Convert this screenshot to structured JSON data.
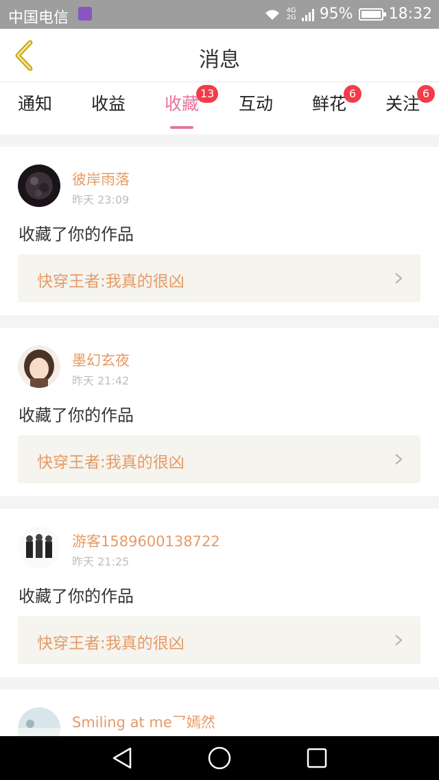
{
  "status_bar": {
    "carrier": "中国电信",
    "network_top": "4G",
    "network_bottom": "2G",
    "battery": "95%",
    "time": "18:32"
  },
  "header": {
    "title": "消息",
    "back_icon": "chevron-left-icon"
  },
  "tabs": [
    {
      "label": "通知",
      "badge": ""
    },
    {
      "label": "收益",
      "badge": ""
    },
    {
      "label": "收藏",
      "badge": "13",
      "active": true
    },
    {
      "label": "互动",
      "badge": ""
    },
    {
      "label": "鲜花",
      "badge": "6"
    },
    {
      "label": "关注",
      "badge": "6"
    }
  ],
  "feed": [
    {
      "user": "彼岸雨落",
      "time": "昨天 23:09",
      "action": "收藏了你的作品",
      "work": "快穿王者:我真的很凶"
    },
    {
      "user": "墨幻玄夜",
      "time": "昨天 21:42",
      "action": "收藏了你的作品",
      "work": "快穿王者:我真的很凶"
    },
    {
      "user": "游客1589600138722",
      "time": "昨天 21:25",
      "action": "收藏了你的作品",
      "work": "快穿王者:我真的很凶"
    },
    {
      "user": "Smiling at me乛嫣然",
      "time": "",
      "action": "",
      "work": ""
    }
  ],
  "colors": {
    "accent": "#e8739c",
    "username": "#e69a66",
    "badge": "#f23c48",
    "back_arrow": "#c8a81e"
  }
}
